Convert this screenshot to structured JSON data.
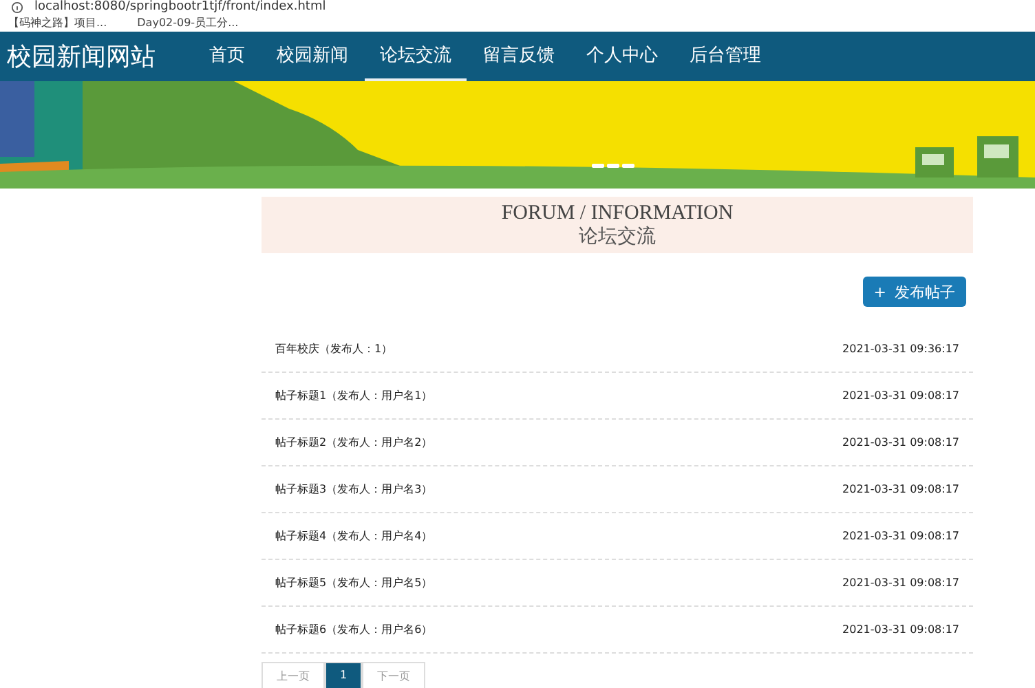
{
  "browser": {
    "url": "localhost:8080/springbootr1tjf/front/index.html",
    "bookmarks": [
      "【码神之路】项目...",
      "Day02-09-员工分..."
    ]
  },
  "site": {
    "title": "校园新闻网站"
  },
  "nav": [
    {
      "label": "首页",
      "selected": false
    },
    {
      "label": "校园新闻",
      "selected": false
    },
    {
      "label": "论坛交流",
      "selected": true
    },
    {
      "label": "留言反馈",
      "selected": false
    },
    {
      "label": "个人中心",
      "selected": false
    },
    {
      "label": "后台管理",
      "selected": false
    }
  ],
  "section": {
    "title_en": "FORUM / INFORMATION",
    "title_cn": "论坛交流"
  },
  "publish_button": {
    "icon": "+",
    "label": "发布帖子"
  },
  "posts": [
    {
      "title": "百年校庆（发布人：1）",
      "time": "2021-03-31 09:36:17"
    },
    {
      "title": "帖子标题1（发布人：用户名1）",
      "time": "2021-03-31 09:08:17"
    },
    {
      "title": "帖子标题2（发布人：用户名2）",
      "time": "2021-03-31 09:08:17"
    },
    {
      "title": "帖子标题3（发布人：用户名3）",
      "time": "2021-03-31 09:08:17"
    },
    {
      "title": "帖子标题4（发布人：用户名4）",
      "time": "2021-03-31 09:08:17"
    },
    {
      "title": "帖子标题5（发布人：用户名5）",
      "time": "2021-03-31 09:08:17"
    },
    {
      "title": "帖子标题6（发布人：用户名6）",
      "time": "2021-03-31 09:08:17"
    }
  ],
  "pagination": [
    {
      "label": "上一页",
      "selected": false
    },
    {
      "label": "1",
      "selected": true
    },
    {
      "label": "下一页",
      "selected": false
    }
  ]
}
